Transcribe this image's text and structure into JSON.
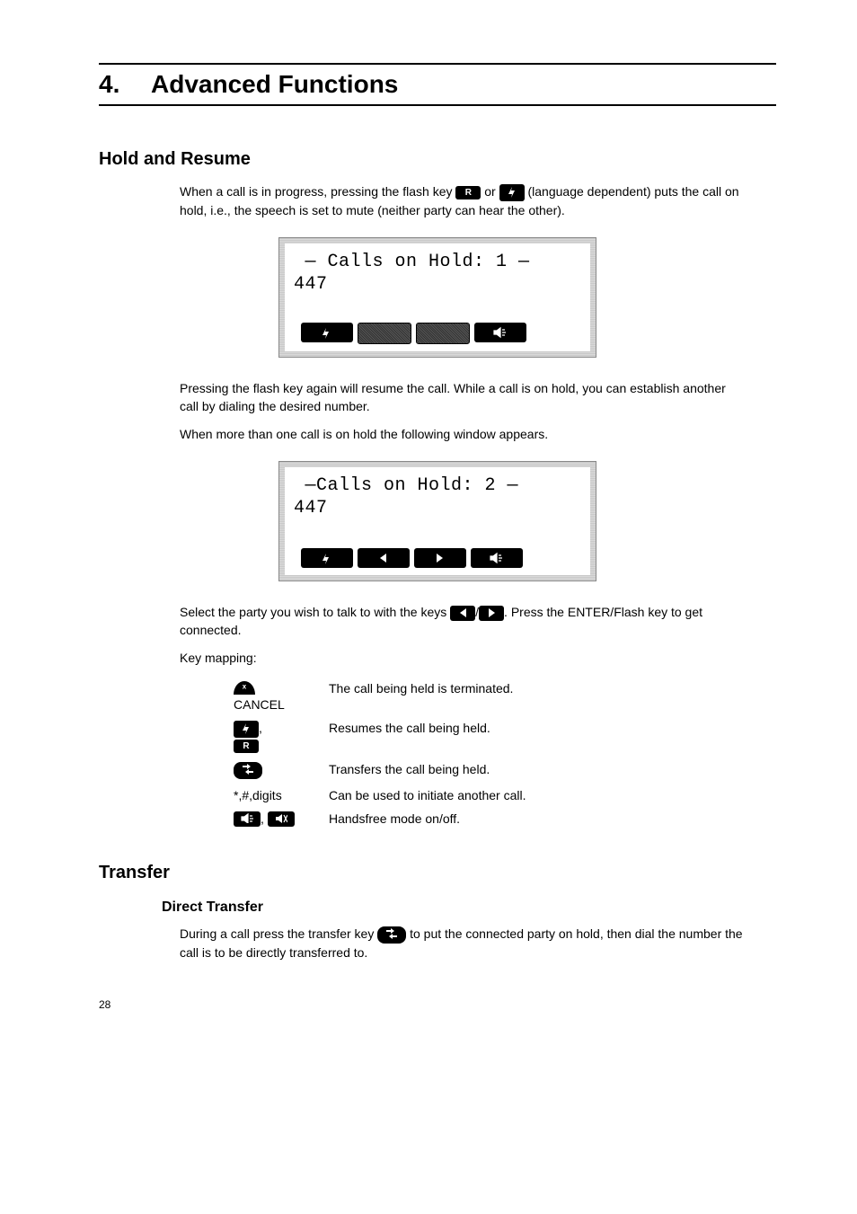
{
  "chapter": {
    "num": "4.",
    "title": "Advanced Functions"
  },
  "hold": {
    "heading": "Hold and Resume",
    "p1a": "When a call is in progress, pressing the flash key ",
    "p1b": " or ",
    "p1c": " (language dependent) puts the call on hold, i.e., the speech is set to mute (neither party can hear the other).",
    "screen1_line1": " — Calls on Hold: 1 —",
    "screen1_line2": "447",
    "p2": "Pressing the flash key again will resume the call. While a call is on hold, you can establish another call by dialing the desired number.",
    "p3": "When more than one call is on hold the following window appears.",
    "screen2_line1": " —Calls on Hold: 2 —",
    "screen2_line2": "447",
    "p4a": "Select the party you wish to talk to with the keys ",
    "p4b": "/",
    "p4c": ".  Press the ENTER/Flash key to get connected.",
    "keymap_label": "Key mapping:",
    "keymap": {
      "cancel_label": "CANCEL",
      "cancel_desc": "The call being held is terminated.",
      "flash_desc": "Resumes the call being held.",
      "transfer_desc": "Transfers the call being held.",
      "digits_label": "*,#,digits",
      "digits_desc": "Can be used to initiate another call.",
      "hf_desc": "Handsfree mode on/off."
    }
  },
  "transfer": {
    "heading": "Transfer",
    "sub": "Direct Transfer",
    "p1a": "During a call press the transfer key ",
    "p1b": " to put the connected party on hold, then dial the number the call is to be directly transferred to."
  },
  "page_number": "28"
}
